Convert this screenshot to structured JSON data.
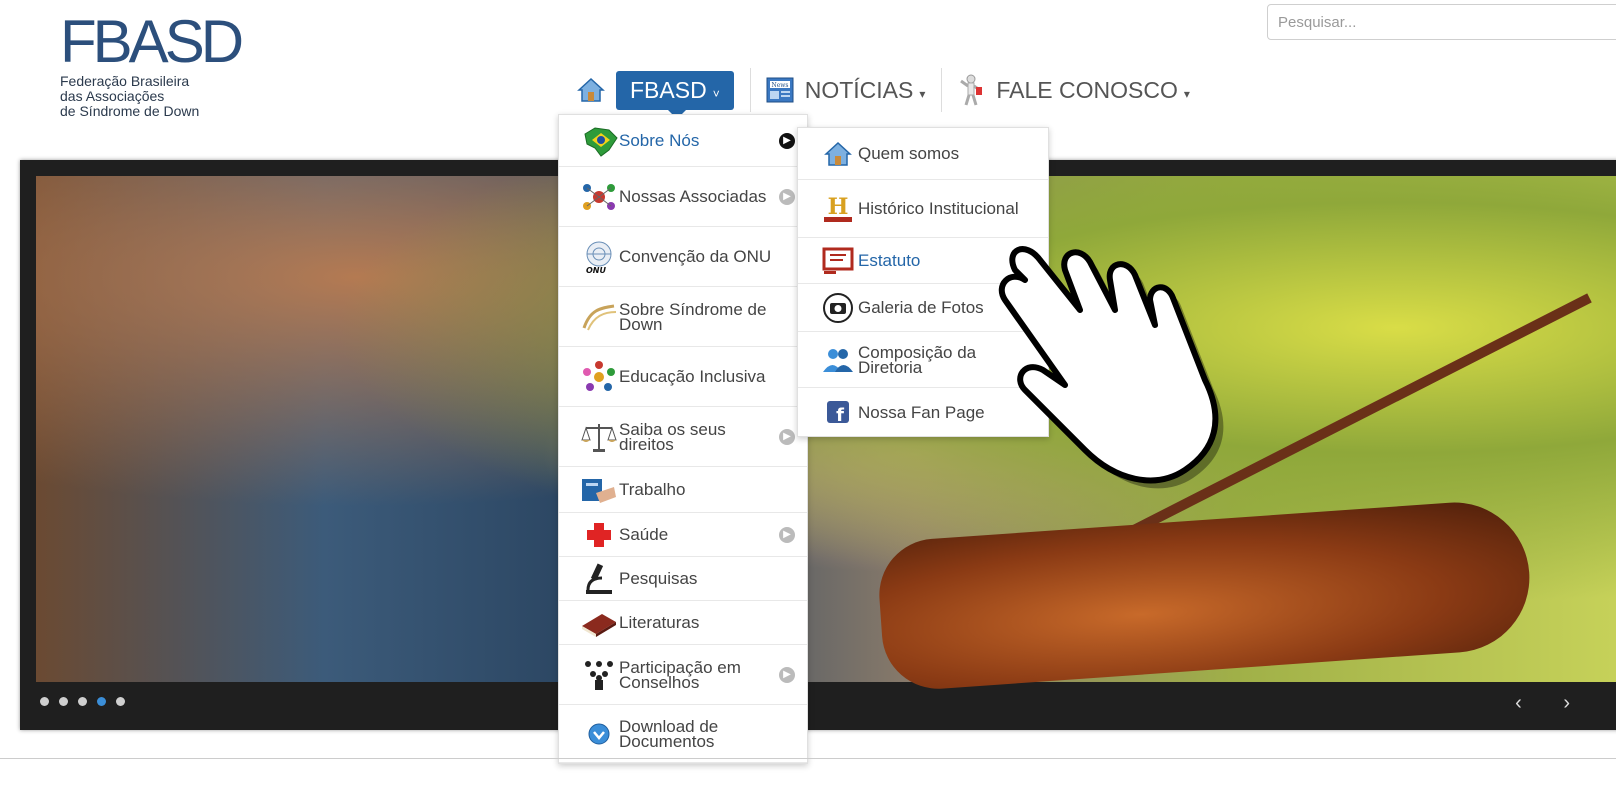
{
  "logo": {
    "mark": "FBASD",
    "line1": "Federação Brasileira",
    "line2": "das Associações",
    "line3": "de Síndrome de Down"
  },
  "search": {
    "placeholder": "Pesquisar..."
  },
  "nav": {
    "items": [
      {
        "label": "FBASD",
        "caret": "˅",
        "icon": "home-icon",
        "active": true
      },
      {
        "label": "NOTÍCIAS",
        "caret": "▾",
        "icon": "news-icon",
        "active": false
      },
      {
        "label": "FALE CONOSCO",
        "caret": "▾",
        "icon": "contact-figure-icon",
        "active": false
      }
    ]
  },
  "menu": {
    "items": [
      {
        "label": "Sobre Nós",
        "icon": "brazil-map-icon",
        "submenu": true,
        "highlighted": true
      },
      {
        "label": "Nossas Associadas",
        "icon": "network-people-icon",
        "submenu": true
      },
      {
        "label": "Convenção da ONU",
        "icon": "un-logo-icon",
        "submenu": false
      },
      {
        "label": "Sobre Síndrome de Down",
        "icon": "chromosome-icon",
        "submenu": false
      },
      {
        "label": "Educação Inclusiva",
        "icon": "people-circle-icon",
        "submenu": false
      },
      {
        "label": "Saiba os seus direitos",
        "icon": "scales-icon",
        "submenu": true
      },
      {
        "label": "Trabalho",
        "icon": "work-icon",
        "submenu": false
      },
      {
        "label": "Saúde",
        "icon": "red-cross-icon",
        "submenu": true
      },
      {
        "label": "Pesquisas",
        "icon": "microscope-icon",
        "submenu": false
      },
      {
        "label": "Literaturas",
        "icon": "book-icon",
        "submenu": false
      },
      {
        "label": "Participação em Conselhos",
        "icon": "council-icon",
        "submenu": true
      },
      {
        "label": "Download de Documentos",
        "icon": "download-icon",
        "submenu": false
      }
    ]
  },
  "submenu": {
    "items": [
      {
        "label": "Quem somos",
        "icon": "home-icon"
      },
      {
        "label": "Histórico Institucional",
        "icon": "history-icon"
      },
      {
        "label": "Estatuto",
        "icon": "statute-icon",
        "highlighted": true
      },
      {
        "label": "Galeria de Fotos",
        "icon": "camera-icon"
      },
      {
        "label": "Composição da Diretoria",
        "icon": "group-icon"
      },
      {
        "label": "Nossa Fan Page",
        "icon": "facebook-icon"
      }
    ]
  },
  "slider": {
    "dot_count": 5,
    "active_dot": 4,
    "prev": "‹",
    "next": "›"
  },
  "colors": {
    "brand": "#2466a8",
    "logo": "#2c4f7c"
  }
}
